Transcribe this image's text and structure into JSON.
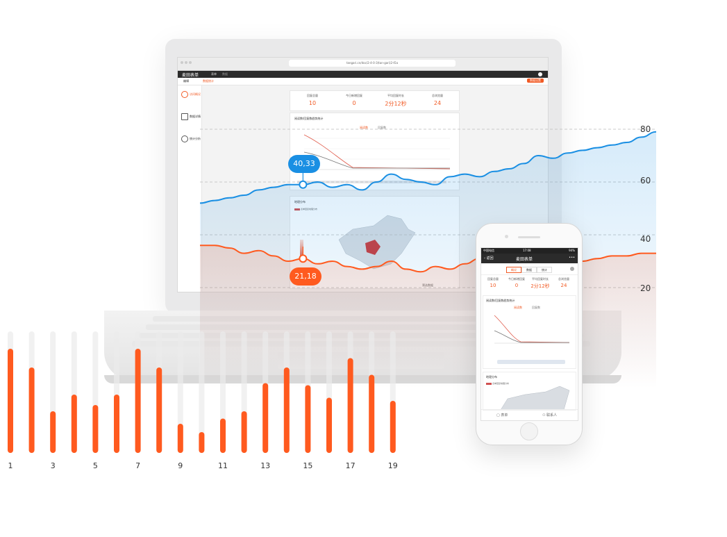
{
  "laptop": {
    "url": "tangari.cn/doc/2-4-0-3(tan-gari)2-t5a",
    "app_logo": "麦田表单",
    "app_nav": [
      "表单",
      "数据"
    ],
    "subbar_tabs": [
      "编辑",
      "数据统计"
    ],
    "subbar_button": "数据设置",
    "sidebar": [
      {
        "label": "访问概况",
        "icon": "chart-circle-icon",
        "active": true
      },
      {
        "label": "数据详情",
        "icon": "clipboard-icon",
        "active": false
      },
      {
        "label": "统计分析",
        "icon": "target-icon",
        "active": false
      }
    ],
    "stats": [
      {
        "label": "回复总量",
        "value": "10"
      },
      {
        "label": "今日新增回复",
        "value": "0"
      },
      {
        "label": "平均回复时长",
        "value": "2分12秒"
      },
      {
        "label": "总浏览量",
        "value": "24"
      }
    ],
    "trend_title": "阅读数/回复数趋势统计",
    "trend_legend": [
      "阅读数",
      "回复数"
    ],
    "geo_title": "地理分布",
    "geo_legend": "表单回复地理分布",
    "geo_button": "筛选数据"
  },
  "phone": {
    "status_carrier": "中国电信",
    "status_time": "17:08",
    "status_battery": "94%",
    "nav_back": "返回",
    "nav_title": "麦田表单",
    "nav_more": "•••",
    "tabs": [
      "概况",
      "数据",
      "统计"
    ],
    "stats": [
      {
        "label": "回复总量",
        "value": "10"
      },
      {
        "label": "今日新增回复",
        "value": "0"
      },
      {
        "label": "平均回复时长",
        "value": "2分12秒"
      },
      {
        "label": "总浏览量",
        "value": "24"
      }
    ],
    "trend_title": "阅读数/回复数趋势统计",
    "trend_legend": [
      "阅读数",
      "回复数"
    ],
    "geo_title": "地理分布",
    "geo_legend": "表单回复地理分布",
    "bottom_left": "表单",
    "bottom_right": "联系人"
  },
  "overlay": {
    "blue_tooltip": "40,33",
    "orange_tooltip": "21,18",
    "colors": {
      "blue": "#1a8fe3",
      "orange": "#ff5a1f"
    }
  },
  "chart_data": [
    {
      "type": "line",
      "title": "",
      "y_ticks": [
        20,
        40,
        60,
        80
      ],
      "ylim": [
        10,
        85
      ],
      "series": [
        {
          "name": "",
          "color": "#1a8fe3",
          "values": [
            52,
            53,
            54,
            55,
            57,
            58,
            59,
            59,
            60,
            58,
            59,
            57,
            60,
            63,
            61,
            60,
            59,
            62,
            63,
            62,
            64,
            65,
            67,
            70,
            69,
            71,
            72,
            73,
            74,
            75,
            77,
            79
          ]
        },
        {
          "name": "",
          "color": "#ff5a1f",
          "values": [
            36,
            36,
            35,
            33,
            34,
            32,
            30,
            31,
            29,
            30,
            28,
            27,
            28,
            30,
            27,
            26,
            28,
            27,
            29,
            31,
            31,
            28,
            31,
            32,
            31,
            32,
            30,
            31,
            32,
            32,
            33,
            33
          ]
        }
      ],
      "highlight_points": [
        {
          "series": 0,
          "label": "40,33"
        },
        {
          "series": 1,
          "label": "21,18"
        }
      ]
    },
    {
      "type": "bar",
      "categories": [
        "1",
        "2",
        "3",
        "4",
        "5",
        "6",
        "7",
        "8",
        "9",
        "10",
        "11",
        "12",
        "13",
        "14",
        "15",
        "16",
        "17",
        "18",
        "19"
      ],
      "x_tick_labels": [
        "1",
        "3",
        "5",
        "7",
        "9",
        "11",
        "13",
        "15",
        "17",
        "19"
      ],
      "values": [
        100,
        82,
        40,
        56,
        46,
        56,
        100,
        82,
        28,
        20,
        33,
        40,
        67,
        82,
        65,
        53,
        91,
        75,
        50
      ],
      "max": 100,
      "color": "#ff5a1f"
    }
  ]
}
